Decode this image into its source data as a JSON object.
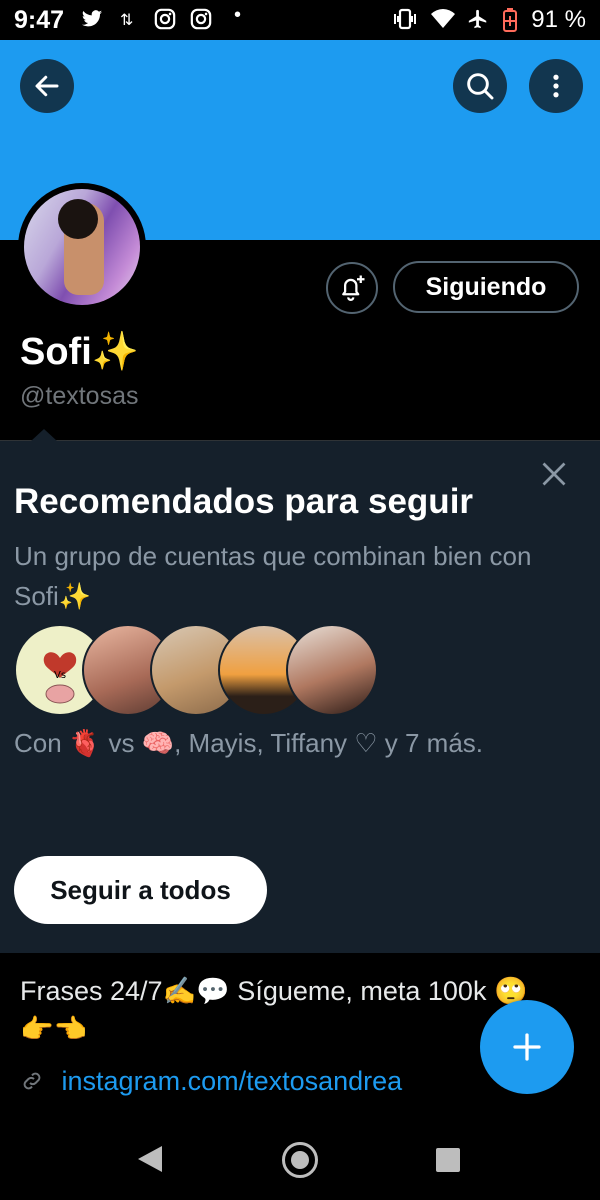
{
  "status_bar": {
    "time": "9:47",
    "battery": "91 %"
  },
  "header": {
    "banner_color": "#1d9bf0",
    "back_icon": "arrow-left-icon",
    "search_icon": "search-icon",
    "more_icon": "more-vertical-icon"
  },
  "profile": {
    "name": "Sofi✨",
    "handle": "@textosas",
    "following_label": "Siguiendo",
    "notify_icon": "bell-plus-icon"
  },
  "recommended": {
    "title": "Recomendados para seguir",
    "description": "Un grupo de cuentas que combinan bien con Sofi✨",
    "followed_by": "Con 🫀 vs 🧠, Mayis, Tiffany ♡ y 7 más.",
    "face_1_label": "Vs",
    "follow_all_label": "Seguir a todos"
  },
  "bio": {
    "text_line1": "Frases 24/7✍️💬 Sígueme, meta 100k 🙄",
    "text_line2": "👉👈",
    "link": "instagram.com/textosandrea"
  },
  "colors": {
    "accent": "#1d9bf0",
    "card_bg": "#15202b",
    "muted": "#71767b"
  }
}
